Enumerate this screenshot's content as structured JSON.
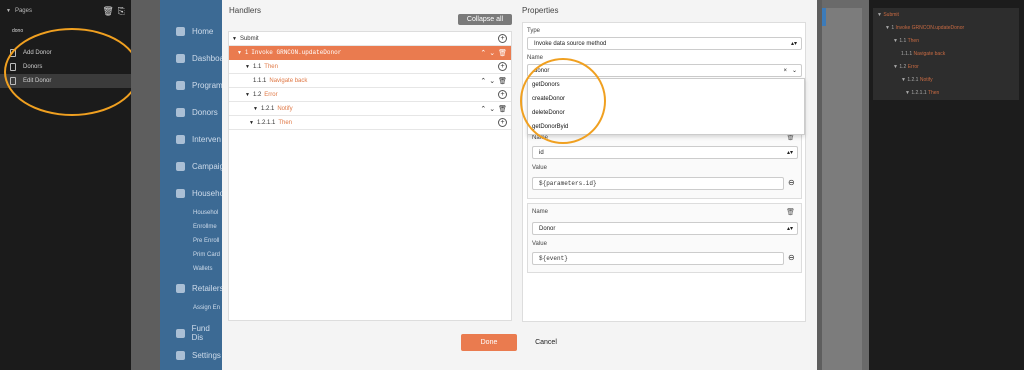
{
  "pages_panel": {
    "title": "Pages",
    "search": "dono",
    "items": [
      {
        "label": "Add Donor",
        "active": false
      },
      {
        "label": "Donors",
        "active": false
      },
      {
        "label": "Edit Donor",
        "active": true
      }
    ]
  },
  "app_sidebar": {
    "items": [
      "Home",
      "Dashboa",
      "Program",
      "Donors",
      "Interven",
      "Campaig",
      "Househo",
      "Retailers",
      "Fund Dis",
      "Settings"
    ],
    "household_sub": [
      "Househol",
      "Enrollme",
      "Pre Enroll",
      "Prim Card",
      "Wallets"
    ],
    "retailers_sub": [
      "Assign En"
    ]
  },
  "handlers": {
    "title": "Handlers",
    "collapse_all": "Collapse all",
    "rows": [
      {
        "num": "",
        "label": "Submit"
      },
      {
        "num": "1",
        "label": "Invoke GRNCON.updateDonor"
      },
      {
        "num": "1.1",
        "label": "Then"
      },
      {
        "num": "1.1.1",
        "label": "Navigate back"
      },
      {
        "num": "1.2",
        "label": "Error"
      },
      {
        "num": "1.2.1",
        "label": "Notify"
      },
      {
        "num": "1.2.1.1",
        "label": "Then"
      }
    ]
  },
  "properties": {
    "title": "Properties",
    "type_label": "Type",
    "type_value": "Invoke data source method",
    "name_label": "Name",
    "name_value": "donor",
    "clear_icon": "×",
    "dropdown_options": [
      "getDonors",
      "createDonor",
      "deleteDonor",
      "getDonorByid"
    ],
    "param1": {
      "name_label": "Name",
      "name_value": "id",
      "value_label": "Value",
      "value_value": "${parameters.id}"
    },
    "param2": {
      "name_label": "Name",
      "name_value": "Donor",
      "value_label": "Value",
      "value_value": "${event}"
    }
  },
  "footer": {
    "done": "Done",
    "cancel": "Cancel"
  },
  "outline": {
    "lines": [
      {
        "prefix": "▼ ",
        "num": "",
        "label": "Submit"
      },
      {
        "prefix": "▼ ",
        "num": "1 ",
        "label": "Invoke GRNCON.updateDonor"
      },
      {
        "prefix": "▼ ",
        "num": "1.1 ",
        "label": "Then"
      },
      {
        "prefix": "",
        "num": "1.1.1 ",
        "label": "Navigate back"
      },
      {
        "prefix": "▼ ",
        "num": "1.2 ",
        "label": "Error"
      },
      {
        "prefix": "▼ ",
        "num": "1.2.1 ",
        "label": "Notify"
      },
      {
        "prefix": "▼ ",
        "num": "1.2.1.1 ",
        "label": "Then"
      }
    ]
  },
  "colors": {
    "accent": "#ea7b4f",
    "sidebar": "#3c6a94",
    "annotation": "#f0a020"
  }
}
